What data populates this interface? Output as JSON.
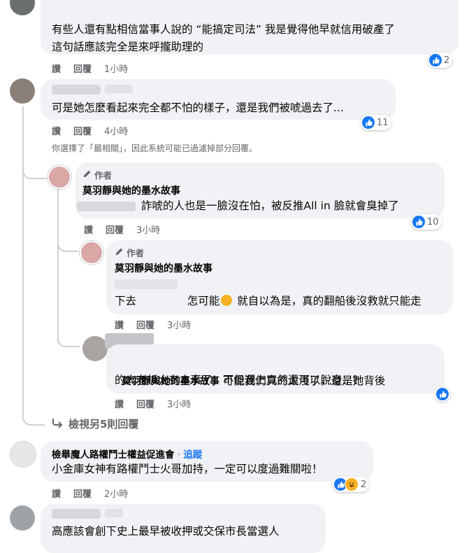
{
  "labels": {
    "reply": "回覆",
    "author_badge": "作者",
    "page_name": "莫羽靜與她的墨水故事",
    "dot": "·",
    "follow": "追蹤"
  },
  "comments": [
    {
      "read": "讚",
      "reply": "回覆",
      "time": "1小時",
      "text": "有些人還有點相信當事人說的 “能搞定司法” 我是覺得他早就信用破產了\n這句話應該完全是來呼攏助理的",
      "reactions": "2"
    },
    {
      "read": "讚",
      "reply": "回覆",
      "time": "4小時",
      "text": "可是她怎麼看起來完全都不怕的樣子，還是我們被唬過去了...",
      "reactions": "11"
    },
    {
      "read": "讚",
      "reply": "回覆",
      "time": "3小時",
      "text": "詐唬的人也是一臉沒在怕，被反推All in 臉就會臭掉了",
      "reactions": "10"
    },
    {
      "read": "讚",
      "reply": "回覆",
      "time": "3小時",
      "text_a": "怎可能",
      "text_b": " 就自以為是，真的翻船後沒救就只能走",
      "text_c": "下去"
    },
    {
      "read": "讚",
      "reply": "回覆",
      "time": "3小時",
      "text_a": "可能我們真的太淺了，還是她背後",
      "text_b": "的大老板太有本事了，不但選上竟然還可以脫身...？"
    },
    {
      "read": "讚",
      "reply": "回覆",
      "time": "2小時",
      "name": "檢舉魔人路權鬥士權益促進會",
      "text": "小金庫女神有路權鬥士火哥加持，一定可以度過難關啦！",
      "reactions": "2"
    },
    {
      "text": "高應該會創下史上最早被收押或交保市長當選人"
    }
  ],
  "filter_note": "你選擇了「最相關」，因此系統可能已過濾掉部分回覆。",
  "view_more": "檢視另5則回覆",
  "colors": {
    "like": "#1877f2",
    "haha": "#f7b125",
    "bubble": "#f0f2f5",
    "meta": "#65676b"
  }
}
